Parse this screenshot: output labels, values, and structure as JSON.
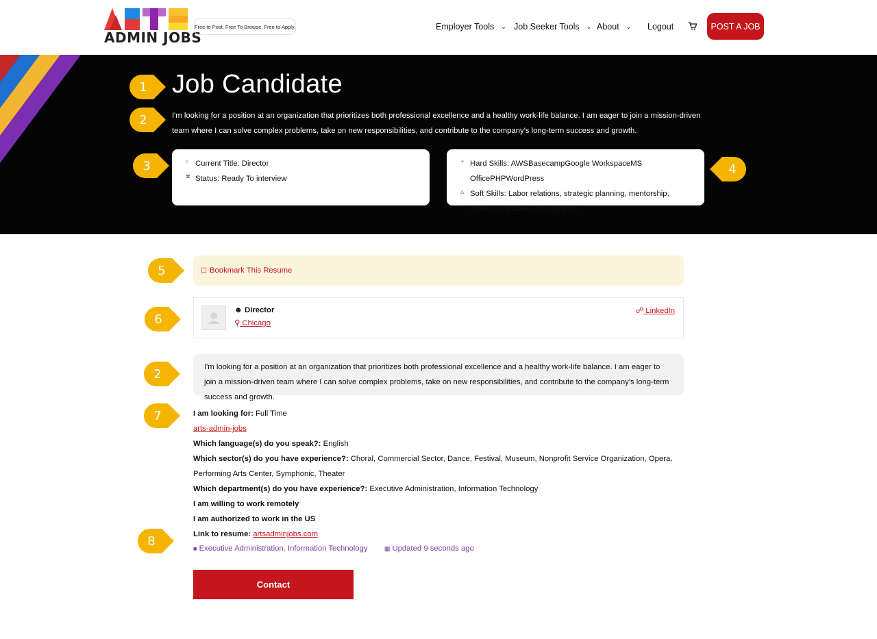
{
  "header": {
    "logo_text": "ADMIN JOBS",
    "logo_letters": "ARTS",
    "tagline": "Free to Post. Free To Browse. Free to Apply.",
    "nav": [
      {
        "label": "Employer Tools",
        "has_dropdown": true
      },
      {
        "label": "Job Seeker Tools",
        "has_dropdown": true
      },
      {
        "label": "About",
        "has_dropdown": true
      },
      {
        "label": "Logout",
        "has_dropdown": false
      }
    ],
    "cart_icon": "cart-icon",
    "post_job_label": "POST A JOB"
  },
  "hero": {
    "title": "Job Candidate",
    "description": "I'm looking for a position at an organization that prioritizes both professional excellence and a healthy work-life balance. I am eager to join a mission-driven team where I can solve complex problems, take on new responsibilities, and contribute to the company's long-term success and growth.",
    "left_card": {
      "current_title": "Current Title: Director",
      "status": "Status: Ready To interview"
    },
    "right_card": {
      "hard_skills": "Hard Skills: AWSBasecampGoogle WorkspaceMS OfficePHPWordPress",
      "soft_skills": "Soft Skills: Labor relations, strategic planning, mentorship, system upgrades and migration."
    }
  },
  "callouts": [
    "1",
    "2",
    "3",
    "4",
    "5",
    "6",
    "2",
    "7",
    "8"
  ],
  "bookmark": {
    "label": "Bookmark This Resume"
  },
  "profile": {
    "title": "Director",
    "location": "Chicago",
    "link_label": "LinkedIn"
  },
  "summary": "I'm looking for a position at an organization that prioritizes both professional excellence and a healthy work-life balance. I am eager to join a mission-driven team where I can solve complex problems, take on new responsibilities, and contribute to the company's long-term success and growth.",
  "details": {
    "looking_for_label": "I am looking for:",
    "looking_for_value": "Full Time",
    "tag_link": "arts-admin-jobs",
    "languages_label": "Which language(s) do you speak?:",
    "languages_value": "English",
    "sectors_label": "Which sector(s) do you have experience?:",
    "sectors_value": "Choral, Commercial Sector, Dance, Festival, Museum, Nonprofit Service Organization, Opera, Performing Arts Center, Symphonic, Theater",
    "departments_label": "Which department(s) do you have experience?:",
    "departments_value": "Executive Administration, Information Technology",
    "remote_label": "I am willing to work remotely",
    "authorized_label": "I am authorized to work in the US",
    "resume_label": "Link to resume:",
    "resume_value": "artsadminjobs.com"
  },
  "meta": {
    "categories": "Executive Administration, Information Technology",
    "updated": "Updated 9 seconds ago"
  },
  "contact_label": "Contact",
  "colors": {
    "brand_red": "#c4161c",
    "callout_orange": "#f4b400",
    "hero_bg": "#050505",
    "meta_purple": "#7a3fa0",
    "bookmark_bg": "#fdf4dc"
  }
}
